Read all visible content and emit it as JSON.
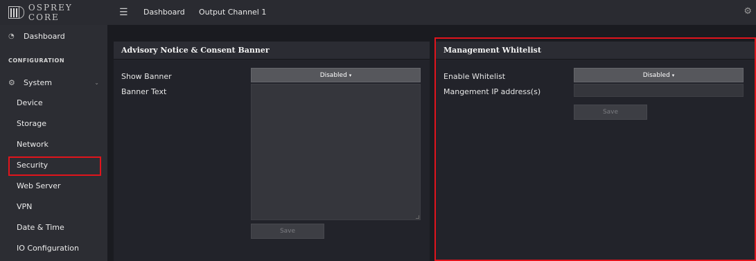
{
  "brand": {
    "name": "OSPREY CORE"
  },
  "topbar": {
    "menu_icon": "hamburger-icon",
    "crumbs": [
      "Dashboard",
      "Output Channel 1"
    ],
    "settings_icon": "gear-icon"
  },
  "sidebar": {
    "dashboard": "Dashboard",
    "section": "CONFIGURATION",
    "system": "System",
    "items": [
      "Device",
      "Storage",
      "Network",
      "Security",
      "Web Server",
      "VPN",
      "Date & Time",
      "IO Configuration"
    ],
    "selected": "Security"
  },
  "advisory": {
    "title": "Advisory Notice & Consent Banner",
    "show_banner_label": "Show Banner",
    "show_banner_value": "Disabled",
    "banner_text_label": "Banner Text",
    "banner_text_value": "",
    "save_label": "Save"
  },
  "whitelist": {
    "title": "Management Whitelist",
    "enable_label": "Enable Whitelist",
    "enable_value": "Disabled",
    "ip_label": "Mangement IP address(s)",
    "ip_value": "",
    "save_label": "Save"
  },
  "highlight_color": "#e2141c"
}
